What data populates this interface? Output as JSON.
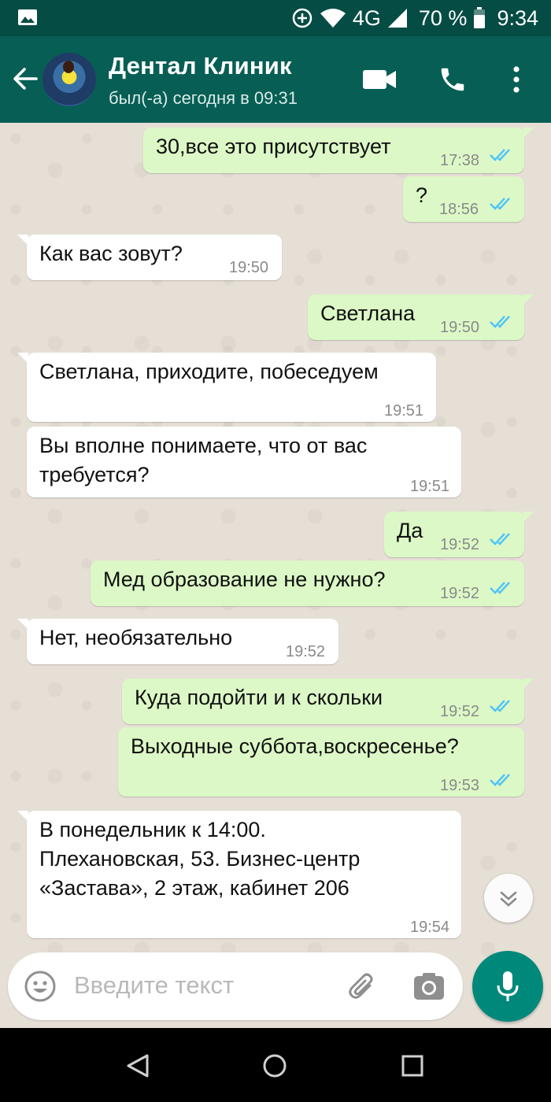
{
  "status_bar": {
    "network": "4G",
    "battery": "70 %",
    "time": "9:34"
  },
  "header": {
    "contact_name": "Дентал Клиник",
    "last_seen": "был(-а) сегодня в 09:31"
  },
  "messages": [
    {
      "direction": "outgoing",
      "text": "30,все это присутствует",
      "time": "17:38",
      "status": "read"
    },
    {
      "direction": "outgoing",
      "text": "?",
      "time": "18:56",
      "status": "read"
    },
    {
      "direction": "incoming",
      "text": "Как вас зовут?",
      "time": "19:50"
    },
    {
      "direction": "outgoing",
      "text": "Светлана",
      "time": "19:50",
      "status": "read"
    },
    {
      "direction": "incoming",
      "text": "Светлана, приходите, побеседуем",
      "time": "19:51"
    },
    {
      "direction": "incoming",
      "text": "Вы вполне понимаете, что от вас\nтребуется?",
      "time": "19:51"
    },
    {
      "direction": "outgoing",
      "text": "Да",
      "time": "19:52",
      "status": "read"
    },
    {
      "direction": "outgoing",
      "text": "Мед образование не нужно?",
      "time": "19:52",
      "status": "read"
    },
    {
      "direction": "incoming",
      "text": "Нет, необязательно",
      "time": "19:52"
    },
    {
      "direction": "outgoing",
      "text": "Куда подойти и к скольки",
      "time": "19:52",
      "status": "read"
    },
    {
      "direction": "outgoing",
      "text": "Выходные суббота,воскресенье?",
      "time": "19:53",
      "status": "read"
    },
    {
      "direction": "incoming",
      "text": "В понедельник к 14:00.\nПлехановская, 53. Бизнес-центр\n«Застава», 2 этаж, кабинет 206",
      "time": "19:54"
    }
  ],
  "composer": {
    "placeholder": "Введите текст"
  },
  "colors": {
    "header": "#075e54",
    "status_bar": "#054c44",
    "outgoing_bubble": "#dcf8c6",
    "incoming_bubble": "#ffffff",
    "read_ticks": "#4fc3f7",
    "fab": "#00897b",
    "chat_background": "#e6dfd6"
  },
  "icons": {
    "status_left": "gallery-notification-icon",
    "header_actions": [
      "video-call-icon",
      "voice-call-icon",
      "more-options-icon"
    ],
    "composer": [
      "emoji-icon",
      "attach-icon",
      "camera-icon"
    ],
    "fab": "microphone-icon",
    "nav": [
      "back-nav-icon",
      "home-nav-icon",
      "recents-nav-icon"
    ]
  }
}
